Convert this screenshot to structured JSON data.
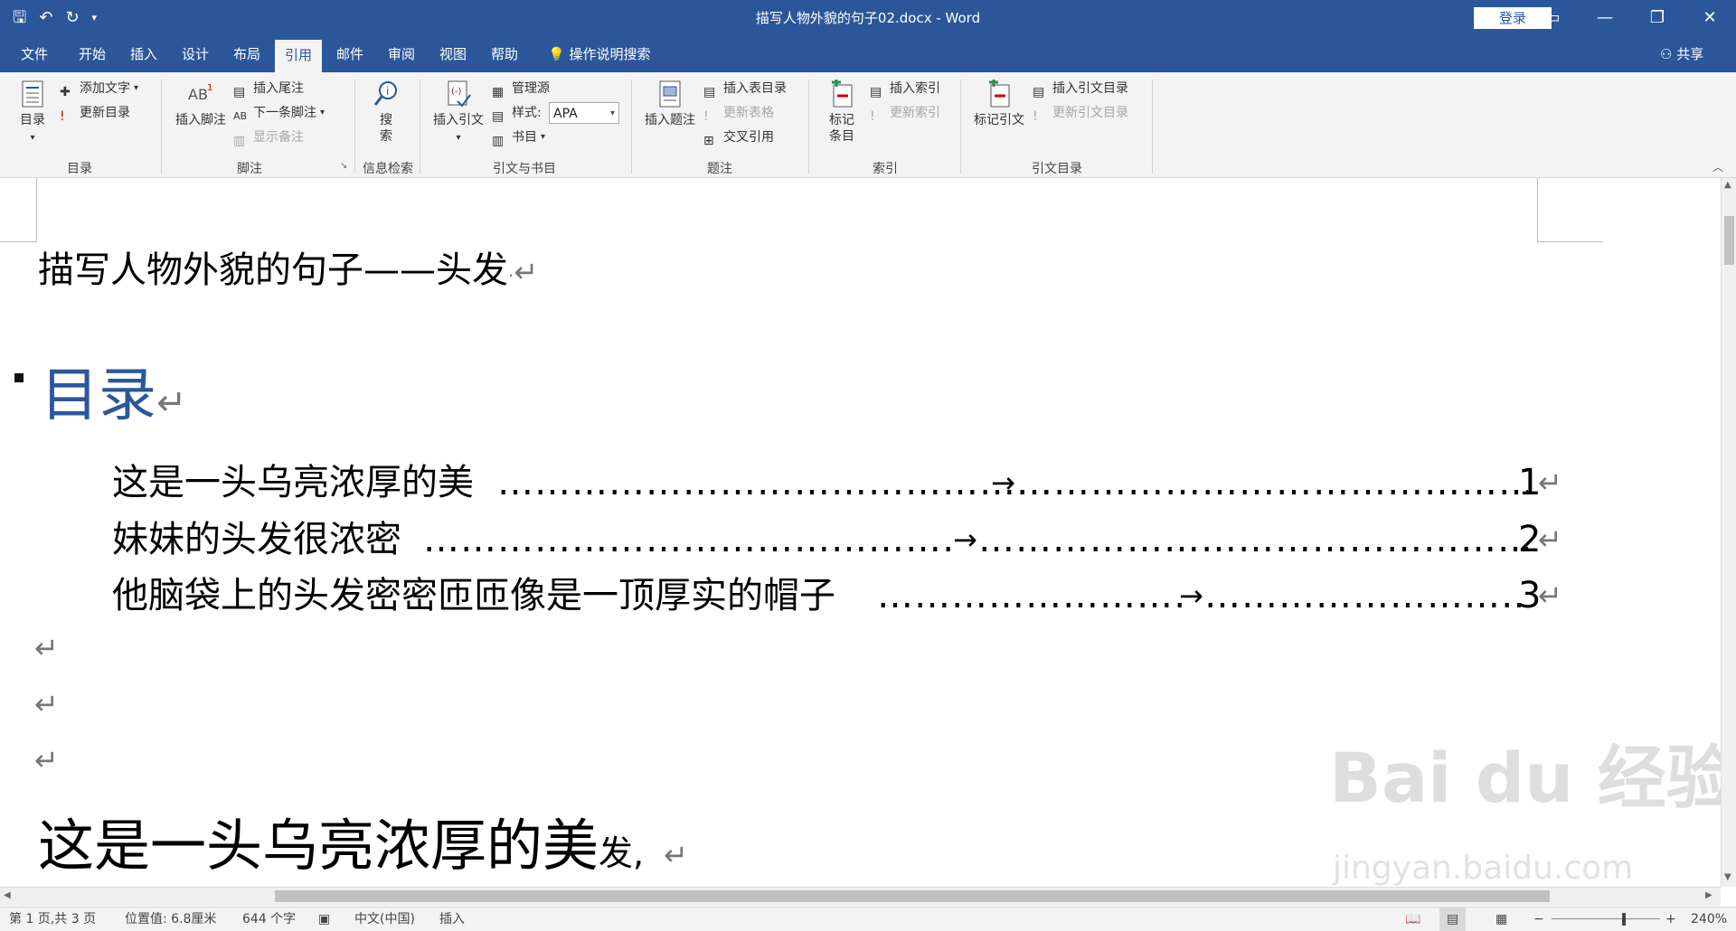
{
  "window": {
    "title": "描写人物外貌的句子02.docx  -  Word",
    "login": "登录"
  },
  "tabs": [
    "文件",
    "开始",
    "插入",
    "设计",
    "布局",
    "引用",
    "邮件",
    "审阅",
    "视图",
    "帮助"
  ],
  "active_tab": "引用",
  "tell_me": "操作说明搜索",
  "share": "共享",
  "ribbon": {
    "toc": {
      "big": "目录",
      "add_text": "添加文字",
      "update": "更新目录",
      "group": "目录"
    },
    "footnotes": {
      "insert_footnote": "插入脚注",
      "insert_endnote": "插入尾注",
      "next_footnote": "下一条脚注",
      "show_notes": "显示备注",
      "group": "脚注"
    },
    "research": {
      "search_line1": "搜",
      "search_line2": "索",
      "group": "信息检索"
    },
    "citations": {
      "insert_citation": "插入引文",
      "manage_sources": "管理源",
      "style_label": "样式:",
      "style_value": "APA",
      "bibliography": "书目",
      "group": "引文与书目"
    },
    "captions": {
      "insert_caption": "插入题注",
      "insert_table_figures": "插入表目录",
      "update_table": "更新表格",
      "cross_ref": "交叉引用",
      "group": "题注"
    },
    "index": {
      "mark_entry_line1": "标记",
      "mark_entry_line2": "条目",
      "insert_index": "插入索引",
      "update_index": "更新索引",
      "group": "索引"
    },
    "authorities": {
      "mark_citation": "标记引文",
      "insert_toa": "插入引文目录",
      "update_toa": "更新引文目录",
      "group": "引文目录"
    }
  },
  "document": {
    "title_line": "描写人物外貌的句子——头发",
    "toc_heading": "目录",
    "toc_entries": [
      {
        "text": "这是一头乌亮浓厚的美",
        "page": "1"
      },
      {
        "text": "妹妹的头发很浓密",
        "page": "2"
      },
      {
        "text": "他脑袋上的头发密密匝匝像是一顶厚实的帽子",
        "page": "3"
      }
    ],
    "heading1_big": "这是一头乌亮浓厚的美",
    "heading1_small": "发,",
    "return_mark": "↵",
    "tab_arrow": "→"
  },
  "statusbar": {
    "page": "第 1 页,共 3 页",
    "position": "位置值: 6.8厘米",
    "words": "644 个字",
    "language": "中文(中国)",
    "mode": "插入",
    "zoom": "240%"
  },
  "watermark": {
    "brand": "Bai du 经验",
    "url": "jingyan.baidu.com"
  }
}
